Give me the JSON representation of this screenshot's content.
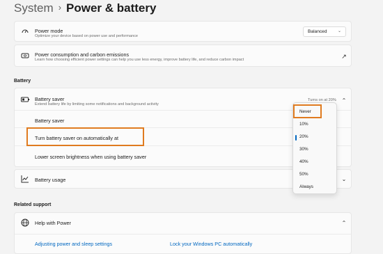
{
  "breadcrumb": {
    "root": "System",
    "separator": "›",
    "current": "Power & battery"
  },
  "power_mode": {
    "title": "Power mode",
    "subtitle": "Optimize your device based on power use and performance",
    "value": "Balanced",
    "icon": "power-mode-icon"
  },
  "consumption": {
    "title": "Power consumption and carbon emissions",
    "subtitle": "Learn how choosing efficient power settings can help you use less energy, improve battery life, and reduce carbon impact",
    "icon": "leaf-icon"
  },
  "battery_section": {
    "header": "Battery",
    "saver": {
      "title": "Battery saver",
      "subtitle": "Extend battery life by limiting some notifications and background activity",
      "status": "Turns on at 20%"
    },
    "rows": {
      "saver_label": "Battery saver",
      "auto_label": "Turn battery saver on automatically at",
      "brightness_label": "Lower screen brightness when using battery saver"
    },
    "usage": {
      "title": "Battery usage"
    }
  },
  "threshold_menu": {
    "options": [
      "Never",
      "10%",
      "20%",
      "30%",
      "40%",
      "50%",
      "Always"
    ],
    "selected": "20%",
    "highlighted": "Never"
  },
  "related_support": {
    "header": "Related support",
    "help_title": "Help with Power",
    "links": [
      "Adjusting power and sleep settings",
      "Lock your Windows PC automatically"
    ]
  },
  "colors": {
    "accent": "#0067c0",
    "highlight": "#e07b1f",
    "background": "#f3f3f3"
  }
}
